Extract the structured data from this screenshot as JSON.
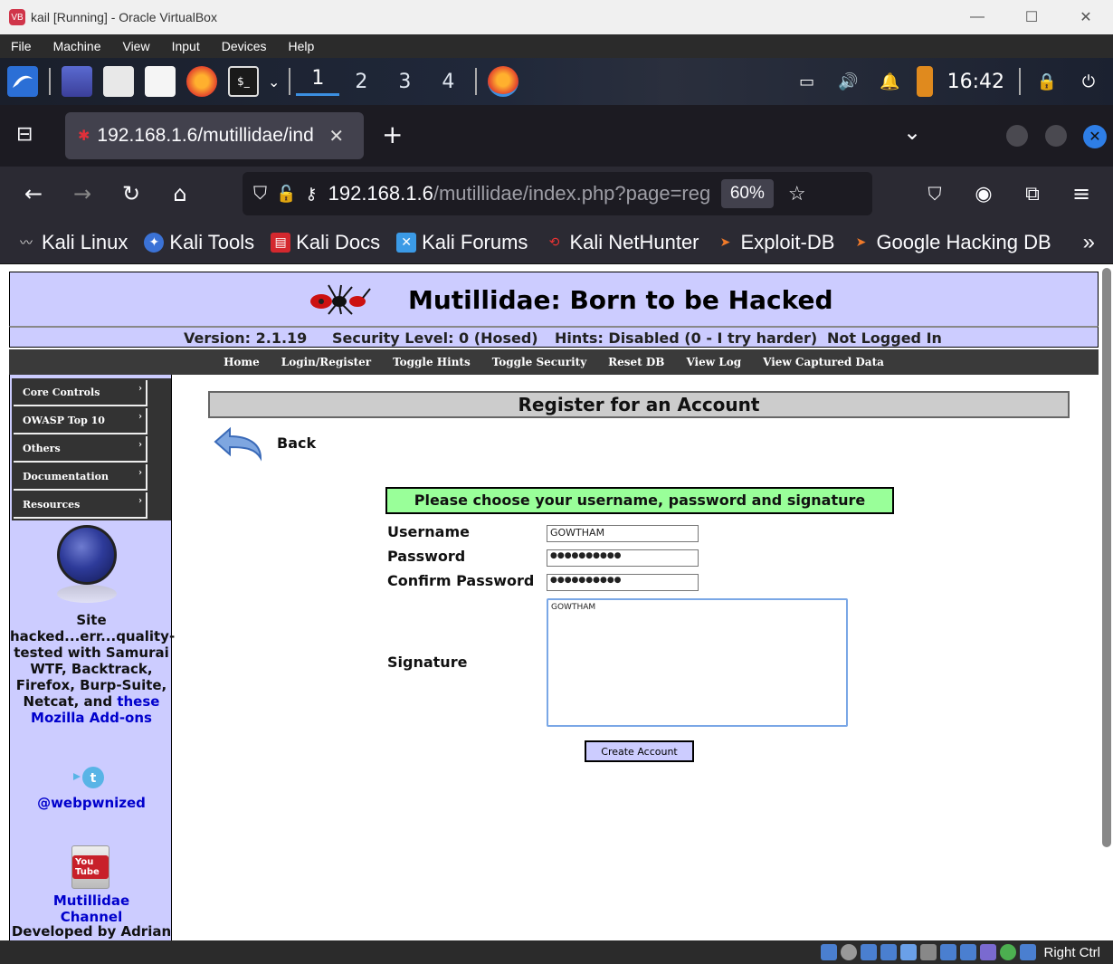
{
  "window": {
    "title": "kail [Running] - Oracle VirtualBox",
    "menu": [
      "File",
      "Machine",
      "View",
      "Input",
      "Devices",
      "Help"
    ],
    "controls": {
      "minimize": "—",
      "maximize": "☐",
      "close": "✕"
    }
  },
  "taskbar": {
    "workspaces": [
      "1",
      "2",
      "3",
      "4"
    ],
    "active_workspace": "1",
    "clock": "16:42"
  },
  "browser": {
    "tab_title": "192.168.1.6/mutillidae/ind",
    "tab_close": "✕",
    "new_tab": "+",
    "url_host": "192.168.1.6",
    "url_path": "/mutillidae/index.php?page=reg",
    "zoom": "60%",
    "bookmarks": [
      "Kali Linux",
      "Kali Tools",
      "Kali Docs",
      "Kali Forums",
      "Kali NetHunter",
      "Exploit-DB",
      "Google Hacking DB"
    ],
    "bookmarks_more": "»"
  },
  "site": {
    "title": "Mutillidae: Born to be Hacked",
    "version": "Version: 2.1.19",
    "security": "Security Level: 0 (Hosed)",
    "hints": "Hints: Disabled (0 - I try harder)",
    "login_status": "Not Logged In",
    "nav": [
      "Home",
      "Login/Register",
      "Toggle Hints",
      "Toggle Security",
      "Reset DB",
      "View Log",
      "View Captured Data"
    ],
    "side_menu": [
      "Core Controls",
      "OWASP Top 10",
      "Others",
      "Documentation",
      "Resources"
    ],
    "side_text_1": "Site hacked...err...quality-tested with Samurai WTF, Backtrack, Firefox, Burp-Suite, Netcat, and",
    "side_text_link": "these Mozilla Add-ons",
    "twitter": "@webpwnized",
    "youtube_label": "You Tube",
    "channel": "Mutillidae Channel",
    "developer": "Developed by Adrian"
  },
  "form": {
    "page_heading": "Register for an Account",
    "back": "Back",
    "instructions": "Please choose your username, password and signature",
    "username_label": "Username",
    "username_value": "GOWTHAM",
    "password_label": "Password",
    "password_value": "●●●●●●●●●●",
    "confirm_label": "Confirm Password",
    "confirm_value": "●●●●●●●●●●",
    "signature_label": "Signature",
    "signature_value": "GOWTHAM",
    "submit": "Create Account"
  },
  "vbox_status": {
    "host_key": "Right Ctrl"
  }
}
